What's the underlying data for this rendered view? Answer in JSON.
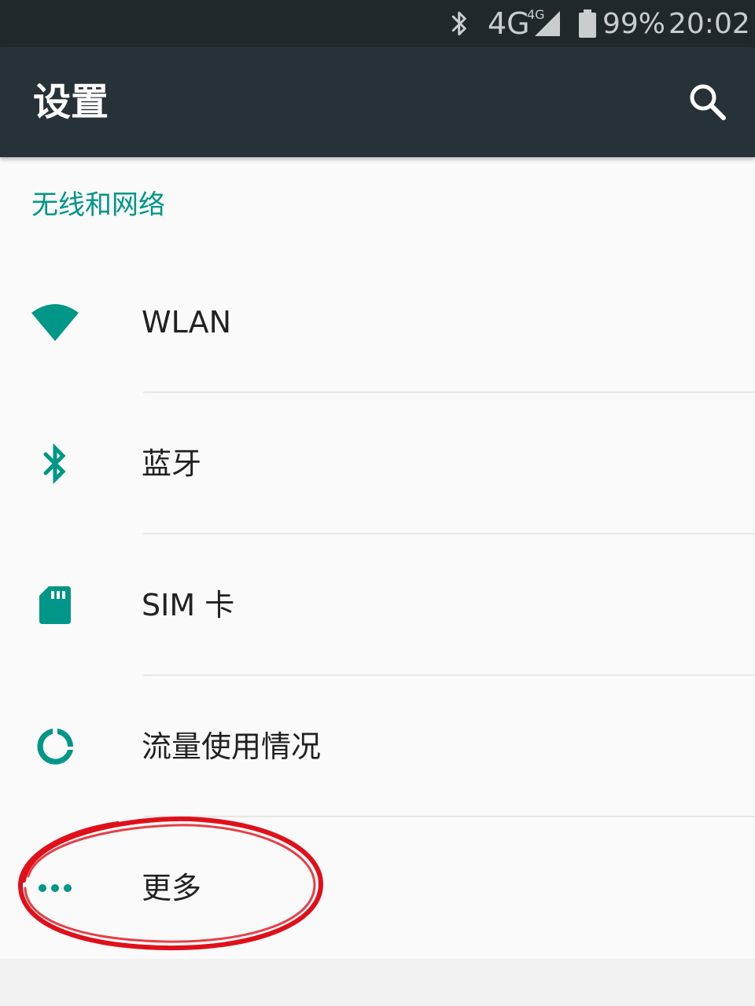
{
  "status_bar": {
    "network": "4G",
    "network_small": "4G",
    "battery": "99%",
    "time": "20:02",
    "icons": [
      "bluetooth-icon",
      "signal-icon",
      "battery-icon"
    ]
  },
  "toolbar": {
    "title": "设置",
    "search_icon": "search-icon"
  },
  "section": {
    "title": "无线和网络"
  },
  "items": [
    {
      "label": "WLAN",
      "icon": "wifi-icon"
    },
    {
      "label": "蓝牙",
      "icon": "bluetooth-icon"
    },
    {
      "label": "SIM 卡",
      "icon": "sim-card-icon"
    },
    {
      "label": "流量使用情况",
      "icon": "data-usage-icon"
    },
    {
      "label": "更多",
      "icon": "more-icon"
    }
  ],
  "colors": {
    "accent": "#009688",
    "toolbar": "#263238",
    "status_bar": "#20282c",
    "annotation": "#e0101a"
  }
}
